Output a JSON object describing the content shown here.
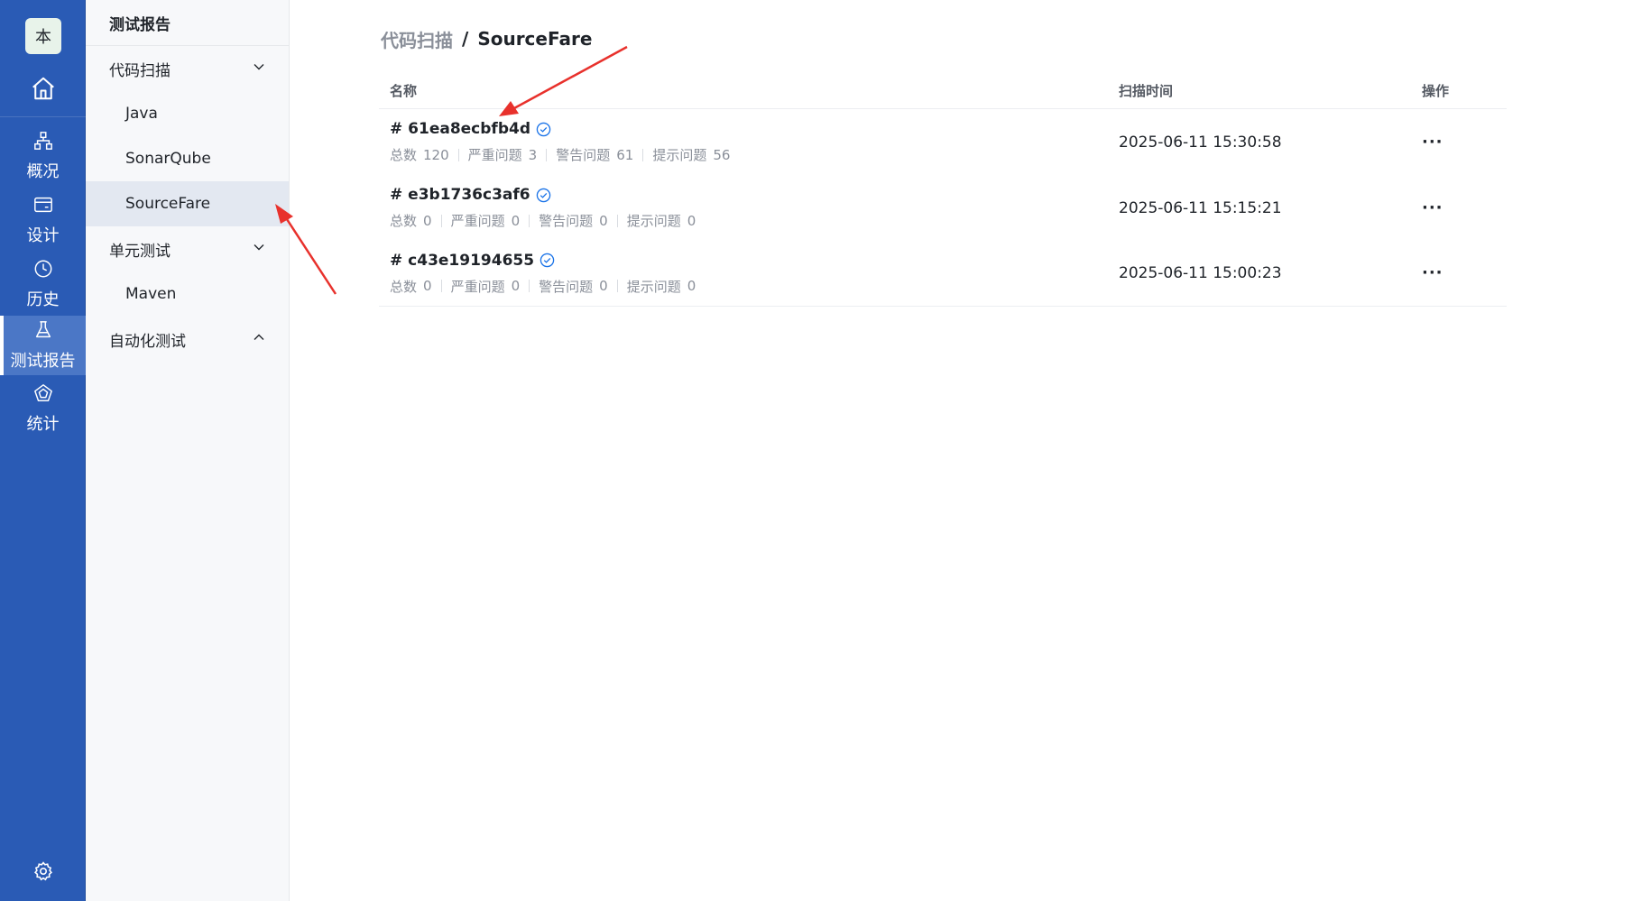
{
  "rail": {
    "logo_text": "本",
    "items": [
      {
        "label": "概况",
        "icon": "sitemap-icon"
      },
      {
        "label": "设计",
        "icon": "card-icon"
      },
      {
        "label": "历史",
        "icon": "clock-icon"
      },
      {
        "label": "测试报告",
        "icon": "flask-icon"
      },
      {
        "label": "统计",
        "icon": "pentagon-chart-icon"
      }
    ],
    "active": "测试报告"
  },
  "subnav": {
    "title": "测试报告",
    "groups": [
      {
        "label": "代码扫描",
        "expanded": true,
        "children": [
          "Java",
          "SonarQube",
          "SourceFare"
        ]
      },
      {
        "label": "单元测试",
        "expanded": true,
        "children": [
          "Maven"
        ]
      },
      {
        "label": "自动化测试",
        "expanded": false,
        "children": []
      }
    ],
    "active_item": "SourceFare"
  },
  "breadcrumb": {
    "parent": "代码扫描",
    "separator": "/",
    "current": "SourceFare"
  },
  "table": {
    "columns": {
      "name": "名称",
      "time": "扫描时间",
      "op": "操作"
    },
    "stat_labels": {
      "total": "总数",
      "critical": "严重问题",
      "warning": "警告问题",
      "info": "提示问题"
    },
    "rows": [
      {
        "title": "# 61ea8ecbfb4d",
        "total": "120",
        "critical": "3",
        "warning": "61",
        "info": "56",
        "time": "2025-06-11 15:30:58",
        "more": "···"
      },
      {
        "title": "# e3b1736c3af6",
        "total": "0",
        "critical": "0",
        "warning": "0",
        "info": "0",
        "time": "2025-06-11 15:15:21",
        "more": "···"
      },
      {
        "title": "# c43e19194655",
        "total": "0",
        "critical": "0",
        "warning": "0",
        "info": "0",
        "time": "2025-06-11 15:00:23",
        "more": "···"
      }
    ]
  },
  "colors": {
    "rail_bg": "#2a5bb5",
    "rail_active": "#4b77c6",
    "check_blue": "#1a73e8",
    "annotation_red": "#e8312c"
  }
}
